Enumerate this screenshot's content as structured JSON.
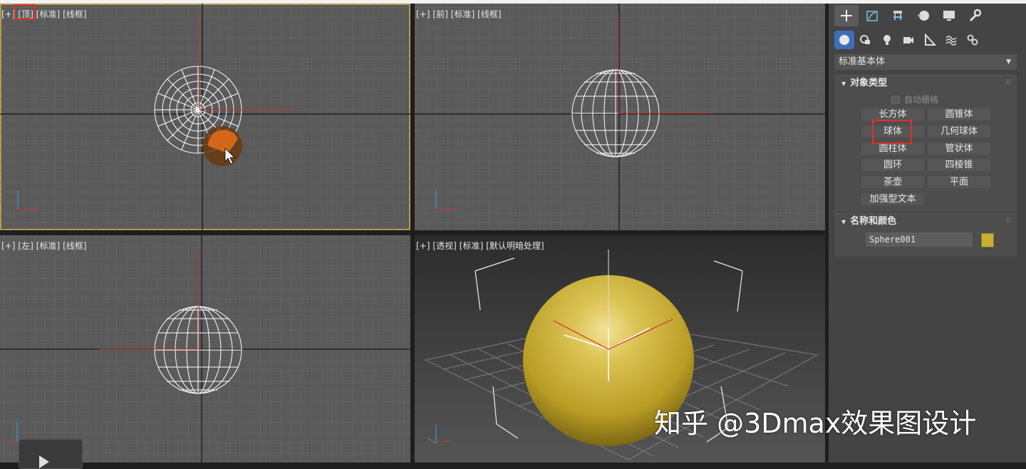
{
  "viewports": {
    "top": {
      "plus": "[+]",
      "view": "[顶]",
      "mode": "[标准]",
      "shade": "[线框]"
    },
    "front": {
      "plus": "[+]",
      "view": "[前]",
      "mode": "[标准]",
      "shade": "[线框]"
    },
    "left": {
      "plus": "[+]",
      "view": "[左]",
      "mode": "[标准]",
      "shade": "[线框]"
    },
    "persp": {
      "plus": "[+]",
      "view": "[透视]",
      "mode": "[标准]",
      "shade": "[默认明暗处理]"
    }
  },
  "panel": {
    "dropdown": "标准基本体",
    "object_type": {
      "title": "对象类型",
      "auto_grid": "自动栅格",
      "buttons": [
        "长方体",
        "圆锥体",
        "球体",
        "几何球体",
        "圆柱体",
        "管状体",
        "圆环",
        "四棱锥",
        "茶壶",
        "平面",
        "加强型文本"
      ]
    },
    "name_color": {
      "title": "名称和颜色",
      "name_value": "Sphere001",
      "color": "#c9b030"
    }
  },
  "watermark": "知乎 @3Dmax效果图设计"
}
